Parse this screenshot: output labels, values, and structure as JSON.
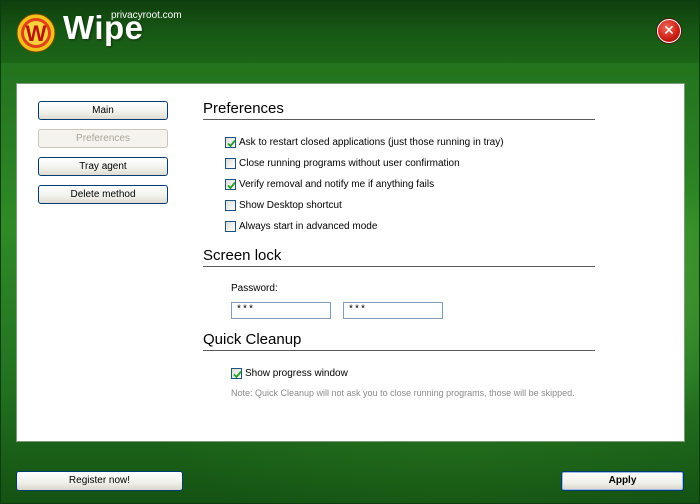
{
  "header": {
    "brand": "Wipe",
    "site": "privacyroot.com",
    "logo_letter": "W",
    "logo_icon": "wipe-logo-icon",
    "close_label": "✕",
    "close_icon": "close-icon"
  },
  "colors": {
    "brand_green": "#1f6a1b",
    "close_red": "#c81d12",
    "accent_check": "#21a121",
    "note_gray": "#8a8a8a"
  },
  "nav": {
    "items": [
      {
        "label": "Main",
        "active": false
      },
      {
        "label": "Preferences",
        "active": true
      },
      {
        "label": "Tray agent",
        "active": false
      },
      {
        "label": "Delete method",
        "active": false
      }
    ]
  },
  "preferences": {
    "title": "Preferences",
    "options": [
      {
        "label": "Ask to restart closed applications (just those running in tray)",
        "checked": true
      },
      {
        "label": "Close running programs without user confirmation",
        "checked": false
      },
      {
        "label": "Verify removal and notify me if anything fails",
        "checked": true
      },
      {
        "label": "Show Desktop shortcut",
        "checked": false
      },
      {
        "label": "Always start in advanced mode",
        "checked": false
      }
    ]
  },
  "screen_lock": {
    "title": "Screen lock",
    "password_label": "Password:",
    "password_value": "***",
    "confirm_value": "***"
  },
  "quick_cleanup": {
    "title": "Quick Cleanup",
    "option_label": "Show progress window",
    "option_checked": true,
    "note": "Note: Quick Cleanup will not ask you to close running programs, those will be skipped."
  },
  "footer": {
    "register_label": "Register now!",
    "apply_label": "Apply"
  }
}
